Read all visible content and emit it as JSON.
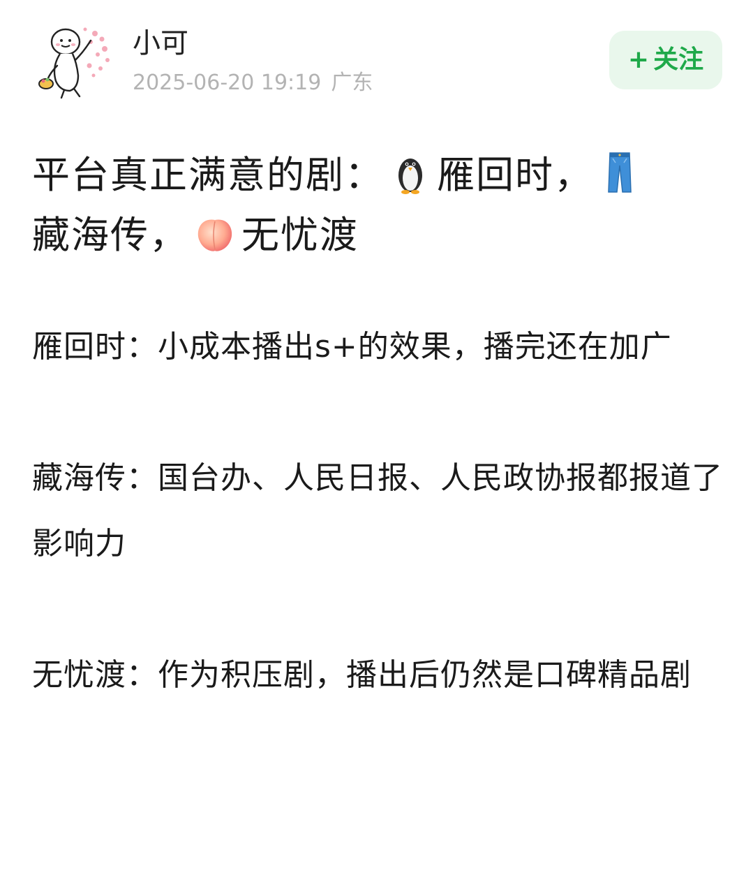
{
  "post": {
    "author": {
      "name": "小可",
      "avatar_icon": "doodle-character-avatar"
    },
    "timestamp": "2025-06-20 19:19",
    "location": "广东",
    "follow_button": {
      "plus": "+",
      "label": "关注"
    },
    "title": {
      "prefix": "平台真正满意的剧：",
      "item1": "雁回时，",
      "item2": "藏海传，",
      "item3": "无忧渡",
      "icons": [
        "penguin-icon",
        "jeans-icon",
        "peach-icon"
      ]
    },
    "paragraphs": [
      {
        "text": "雁回时：小成本播出s+的效果，播完还在加广"
      },
      {
        "text": "藏海传：国台办、人民日报、人民政协报都报道了影响力"
      },
      {
        "text": "无忧渡：作为积压剧，播出后仍然是口碑精品剧"
      }
    ]
  },
  "colors": {
    "follow_bg": "#e9f7ec",
    "follow_text": "#1fa94a",
    "meta_text": "#b3b3b3"
  }
}
